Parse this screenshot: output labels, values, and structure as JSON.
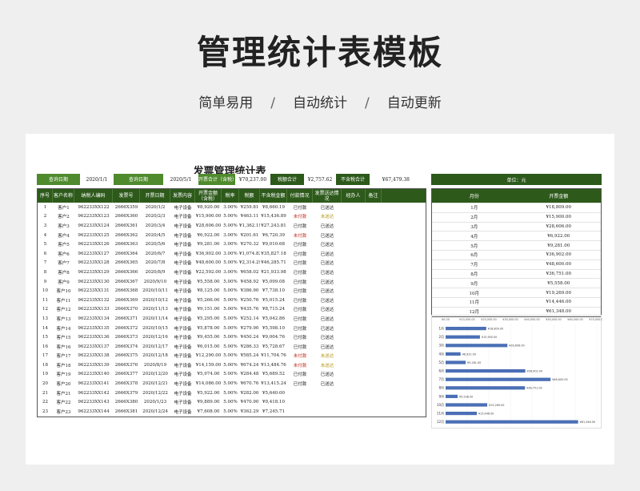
{
  "header": {
    "title": "管理统计表模板",
    "tags": [
      "简单易用",
      "自动统计",
      "自动更新"
    ],
    "sep": "/"
  },
  "sheet": {
    "title": "发票管理统计表",
    "query_start_label": "查询日期",
    "query_start": "2020/1/1",
    "query_end_label": "查询日期",
    "query_end": "2020/5/1",
    "invoice_total_label": "开票合计（含税）",
    "invoice_total": "¥70,237.00",
    "tax_total_label": "税额合计",
    "tax_total": "¥2,757.62",
    "pretax_total_label": "不含税合计",
    "pretax_total": "¥67,479.38",
    "unit_label": "单位：元"
  },
  "table": {
    "headers": [
      "序号",
      "客户名称",
      "纳税人编码",
      "发票号",
      "开票日期",
      "发票内容",
      "开票金额（含税）",
      "税率",
      "税额",
      "不含税金额",
      "付款情况",
      "发票送达情况",
      "经办人",
      "备注"
    ],
    "rows": [
      [
        "1",
        "客户1",
        "962233XX122",
        "2666X359",
        "2020/1/2",
        "电子设备",
        "¥8,920.00",
        "3.00%",
        "¥259.81",
        "¥8,660.19",
        "已付款",
        "已送达"
      ],
      [
        "2",
        "客户2",
        "962233XX123",
        "2666X360",
        "2020/2/3",
        "电子设备",
        "¥15,900.00",
        "5.00%",
        "¥463.11",
        "¥15,436.89",
        "未付款",
        "未送达"
      ],
      [
        "3",
        "客户3",
        "962233XX124",
        "2666X361",
        "2020/3/4",
        "电子设备",
        "¥28,606.00",
        "5.00%",
        "¥1,362.19",
        "¥27,243.81",
        "已付款",
        "已送达"
      ],
      [
        "4",
        "客户4",
        "962233XX125",
        "2666X362",
        "2020/4/5",
        "电子设备",
        "¥6,922.00",
        "3.00%",
        "¥201.61",
        "¥6,720.39",
        "未付款",
        "已送达"
      ],
      [
        "5",
        "客户5",
        "962233XX126",
        "2666X363",
        "2020/5/6",
        "电子设备",
        "¥9,281.00",
        "3.00%",
        "¥270.32",
        "¥9,010.68",
        "已付款",
        "已送达"
      ],
      [
        "6",
        "客户6",
        "962233XX127",
        "2666X364",
        "2020/6/7",
        "电子设备",
        "¥36,902.00",
        "3.00%",
        "¥1,074.82",
        "¥35,827.18",
        "已付款",
        "已送达"
      ],
      [
        "7",
        "客户7",
        "962233XX128",
        "2666X365",
        "2020/7/8",
        "电子设备",
        "¥48,600.00",
        "5.00%",
        "¥2,314.29",
        "¥46,285.71",
        "已付款",
        "已送达"
      ],
      [
        "8",
        "客户8",
        "962233XX129",
        "2666X366",
        "2020/8/9",
        "电子设备",
        "¥22,592.00",
        "3.00%",
        "¥658.02",
        "¥21,933.98",
        "已付款",
        "已送达"
      ],
      [
        "9",
        "客户9",
        "962233XX130",
        "2666X367",
        "2020/9/10",
        "电子设备",
        "¥5,558.00",
        "5.00%",
        "¥458.92",
        "¥5,099.08",
        "已付款",
        "已送达"
      ],
      [
        "10",
        "客户10",
        "962233XX131",
        "2666X368",
        "2020/10/11",
        "电子设备",
        "¥8,125.00",
        "5.00%",
        "¥386.90",
        "¥7,738.10",
        "已付款",
        "已送达"
      ],
      [
        "11",
        "客户11",
        "962233XX132",
        "2666X369",
        "2020/10/12",
        "电子设备",
        "¥5,266.00",
        "5.00%",
        "¥250.76",
        "¥5,015.24",
        "已付款",
        "已送达"
      ],
      [
        "12",
        "客户12",
        "962233XX133",
        "2666X370",
        "2020/11/13",
        "电子设备",
        "¥9,151.00",
        "5.00%",
        "¥435.76",
        "¥8,715.24",
        "已付款",
        "已送达"
      ],
      [
        "13",
        "客户13",
        "962233XX134",
        "2666X371",
        "2020/11/14",
        "电子设备",
        "¥5,295.00",
        "5.00%",
        "¥252.14",
        "¥5,042.86",
        "已付款",
        "已送达"
      ],
      [
        "14",
        "客户14",
        "962233XX135",
        "2666X372",
        "2020/10/15",
        "电子设备",
        "¥5,878.00",
        "5.00%",
        "¥279.90",
        "¥5,598.10",
        "已付款",
        "已送达"
      ],
      [
        "15",
        "客户15",
        "962233XX136",
        "2666X373",
        "2020/12/16",
        "电子设备",
        "¥9,455.00",
        "5.00%",
        "¥450.24",
        "¥9,004.76",
        "已付款",
        "已送达"
      ],
      [
        "16",
        "客户16",
        "962233XX137",
        "2666X374",
        "2020/12/17",
        "电子设备",
        "¥6,015.00",
        "5.00%",
        "¥286.33",
        "¥5,728.67",
        "已付款",
        "已送达"
      ],
      [
        "17",
        "客户17",
        "962233XX138",
        "2666X375",
        "2020/12/18",
        "电子设备",
        "¥12,290.00",
        "5.00%",
        "¥585.24",
        "¥11,704.76",
        "未付款",
        "未送达"
      ],
      [
        "18",
        "客户18",
        "962233XX139",
        "2666X376",
        "2020/8/19",
        "电子设备",
        "¥14,159.00",
        "5.00%",
        "¥674.24",
        "¥13,484.76",
        "未付款",
        "未送达"
      ],
      [
        "19",
        "客户19",
        "962233XX140",
        "2666X377",
        "2020/12/20",
        "电子设备",
        "¥5,974.00",
        "5.00%",
        "¥284.48",
        "¥5,689.52",
        "已付款",
        "已送达"
      ],
      [
        "20",
        "客户20",
        "962233XX141",
        "2666X378",
        "2020/12/21",
        "电子设备",
        "¥14,086.00",
        "5.00%",
        "¥670.76",
        "¥13,415.24",
        "已付款",
        "已送达"
      ],
      [
        "21",
        "客户21",
        "962233XX142",
        "2666X379",
        "2020/12/22",
        "电子设备",
        "¥5,922.00",
        "5.00%",
        "¥282.00",
        "¥5,640.00",
        "",
        ""
      ],
      [
        "22",
        "客户22",
        "962233XX143",
        "2666X380",
        "2020/1/23",
        "电子设备",
        "¥9,889.00",
        "5.00%",
        "¥470.90",
        "¥9,418.10",
        "",
        ""
      ],
      [
        "23",
        "客户23",
        "962233XX144",
        "2666X381",
        "2020/12/24",
        "电子设备",
        "¥7,608.00",
        "5.00%",
        "¥362.29",
        "¥7,245.71",
        "",
        ""
      ]
    ]
  },
  "summary": {
    "headers": [
      "月份",
      "开票金额"
    ],
    "rows": [
      [
        "1月",
        "¥18,809.00"
      ],
      [
        "2月",
        "¥15,900.00"
      ],
      [
        "3月",
        "¥28,606.00"
      ],
      [
        "4月",
        "¥6,922.00"
      ],
      [
        "5月",
        "¥9,281.00"
      ],
      [
        "6月",
        "¥36,902.00"
      ],
      [
        "7月",
        "¥48,600.00"
      ],
      [
        "8月",
        "¥36,751.00"
      ],
      [
        "9月",
        "¥5,558.00"
      ],
      [
        "10月",
        "¥19,269.00"
      ],
      [
        "11月",
        "¥14,446.00"
      ],
      [
        "12月",
        "¥61,348.00"
      ]
    ]
  },
  "chart_data": {
    "type": "bar",
    "orientation": "horizontal",
    "categories": [
      "1月",
      "2月",
      "3月",
      "4月",
      "5月",
      "6月",
      "7月",
      "8月",
      "9月",
      "10月",
      "11月",
      "12月"
    ],
    "values": [
      18809,
      15900,
      28606,
      6922,
      9281,
      36902,
      48600,
      36751,
      5558,
      19269,
      14446,
      61348
    ],
    "labels": [
      "¥18,809.00",
      "¥15,900.00",
      "¥28,606.00",
      "¥6,922.00",
      "¥9,281.00",
      "¥36,902.00",
      "¥48,600.00",
      "¥36,751.00",
      "¥5,538.00",
      "¥19,269.00",
      "¥15,446.00",
      "¥61,348.00"
    ],
    "xticks": [
      "¥0.00",
      "¥10,000.00",
      "¥20,000.00",
      "¥30,000.00",
      "¥40,000.00",
      "¥50,000.00",
      "¥60,000.00",
      "¥70,000.00"
    ],
    "xlim": [
      0,
      70000
    ],
    "bar_color": "#4a6fb5"
  }
}
